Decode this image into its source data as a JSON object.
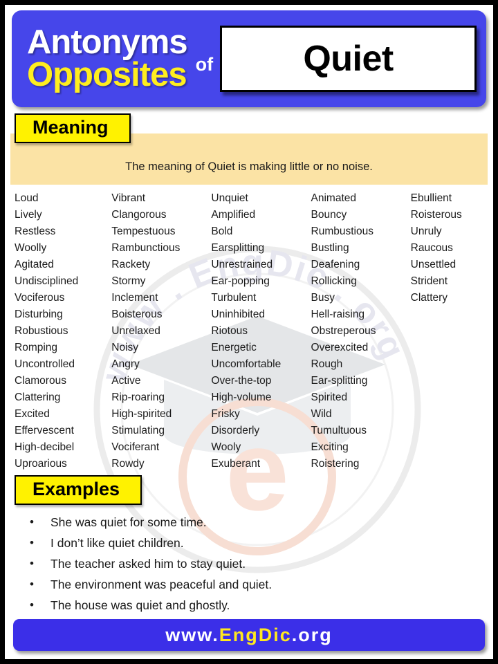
{
  "header": {
    "line1": "Antonyms",
    "line2": "Opposites",
    "connector": "of",
    "word": "Quiet",
    "brand_blue": "#4646ea",
    "accent_yellow": "#ffee1f"
  },
  "meaning": {
    "label": "Meaning",
    "text": "The meaning of Quiet is making little or no noise.",
    "band_color": "#fbe3a5",
    "label_color": "#fff200"
  },
  "antonym_columns": [
    {
      "words": [
        "Loud",
        "Lively",
        "Restless",
        "Woolly",
        "Agitated",
        "Undisciplined",
        "Vociferous",
        "Disturbing",
        "Robustious",
        "Romping",
        "Uncontrolled",
        "Clamorous",
        "Clattering",
        "Excited",
        "Effervescent",
        "High-decibel",
        "Uproarious"
      ]
    },
    {
      "words": [
        "Vibrant",
        "Clangorous",
        "Tempestuous",
        "Rambunctious",
        "Rackety",
        "Stormy",
        "Inclement",
        "Boisterous",
        "Unrelaxed",
        "Noisy",
        "Angry",
        "Active",
        "Rip-roaring",
        "High-spirited",
        "Stimulating",
        "Vociferant",
        "Rowdy"
      ]
    },
    {
      "words": [
        "Unquiet",
        "Amplified",
        "Bold",
        "Earsplitting",
        "Unrestrained",
        "Ear-popping",
        "Turbulent",
        "Uninhibited",
        "Riotous",
        "Energetic",
        "Uncomfortable",
        "Over-the-top",
        "High-volume",
        "Frisky",
        "Disorderly",
        "Wooly",
        "Exuberant"
      ]
    },
    {
      "words": [
        "Animated",
        "Bouncy",
        "Rumbustious",
        "Bustling",
        "Deafening",
        "Rollicking",
        "Busy",
        "Hell-raising",
        "Obstreperous",
        "Overexcited",
        "Rough",
        "Ear-splitting",
        "Spirited",
        "Wild",
        "Tumultuous",
        "Exciting",
        "Roistering"
      ]
    },
    {
      "words": [
        "Ebullient",
        "Roisterous",
        "Unruly",
        "Raucous",
        "Unsettled",
        "Strident",
        "Clattery"
      ]
    }
  ],
  "examples": {
    "label": "Examples",
    "bullet": "•",
    "items": [
      "She was quiet for some time.",
      "I don’t like quiet children.",
      "The teacher asked him to stay quiet.",
      "The environment was peaceful and quiet.",
      "The house was quiet and ghostly."
    ]
  },
  "footer": {
    "prefix": "www.",
    "brand": "EngDic",
    "suffix": ".org",
    "bar_color": "#3b2fe8"
  },
  "watermark": {
    "curved_text": "www . EngDic . org",
    "logo_letter": "e"
  }
}
